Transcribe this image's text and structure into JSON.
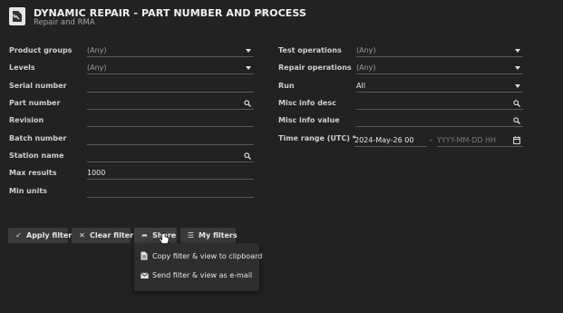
{
  "header": {
    "title": "DYNAMIC REPAIR - PART NUMBER AND PROCESS",
    "subtitle": "Repair and RMA",
    "favorite_icon": "star-outline-icon",
    "app_icon": "wrench-document-icon"
  },
  "filters_left": [
    {
      "label": "Product groups",
      "value": "(Any)",
      "kind": "dropdown"
    },
    {
      "label": "Levels",
      "value": "(Any)",
      "kind": "dropdown"
    },
    {
      "label": "Serial number",
      "value": "",
      "kind": "text"
    },
    {
      "label": "Part number",
      "value": "",
      "kind": "search"
    },
    {
      "label": "Revision",
      "value": "",
      "kind": "text"
    },
    {
      "label": "Batch number",
      "value": "",
      "kind": "text"
    },
    {
      "label": "Station name",
      "value": "",
      "kind": "search"
    },
    {
      "label": "Max results",
      "value": "1000",
      "kind": "text"
    },
    {
      "label": "Min units",
      "value": "",
      "kind": "text"
    }
  ],
  "filters_right": [
    {
      "label": "Test operations",
      "value": "(Any)",
      "kind": "dropdown"
    },
    {
      "label": "Repair operations",
      "value": "(Any)",
      "kind": "dropdown"
    },
    {
      "label": "Run",
      "value": "All",
      "kind": "dropdown"
    },
    {
      "label": "Misc info desc",
      "value": "",
      "kind": "search"
    },
    {
      "label": "Misc info value",
      "value": "",
      "kind": "search"
    }
  ],
  "time_range": {
    "label": "Time range (UTC) *",
    "from_value": "2024-May-26 00",
    "separator": "-",
    "to_placeholder": "YYYY-MM-DD HH"
  },
  "buttons": {
    "apply": "Apply filter",
    "clear": "Clear filter",
    "share": "Share",
    "my_filters": "My filters"
  },
  "share_menu": {
    "copy": "Copy filter & view to clipboard",
    "email": "Send filter & view as e-mail"
  },
  "colors": {
    "background": "#222222",
    "button": "#3a3a3a",
    "menu": "#2e2e2e",
    "text": "#d6d6d6"
  }
}
